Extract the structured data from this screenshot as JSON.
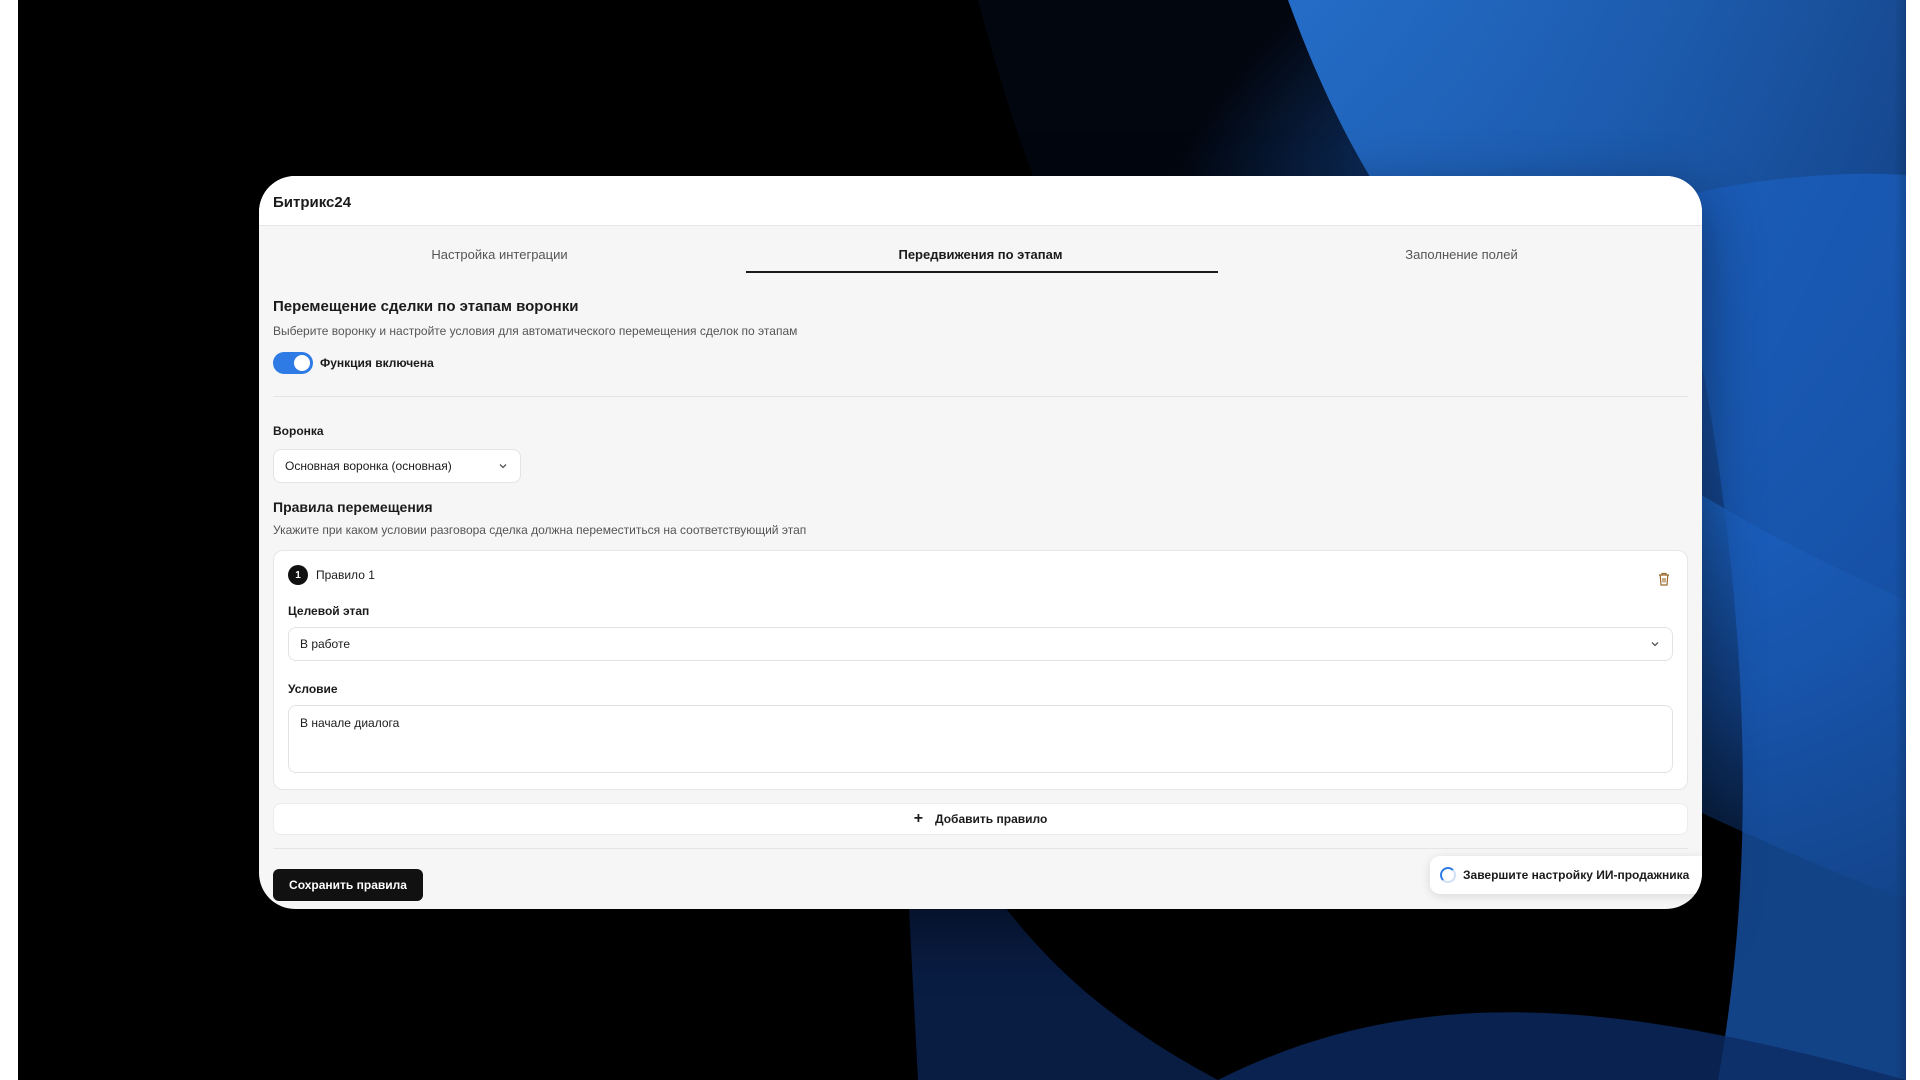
{
  "window": {
    "title": "Битрикс24"
  },
  "tabs": [
    {
      "label": "Настройка интеграции",
      "active": false
    },
    {
      "label": "Передвижения по этапам",
      "active": true
    },
    {
      "label": "Заполнение полей",
      "active": false
    }
  ],
  "section": {
    "title": "Перемещение сделки по этапам воронки",
    "description": "Выберите воронку и настройте условия для автоматического перемещения сделок по этапам",
    "toggle": {
      "label": "Функция включена",
      "on": true
    }
  },
  "funnel": {
    "label": "Воронка",
    "selected": "Основная воронка (основная)"
  },
  "rules": {
    "title": "Правила перемещения",
    "description": "Укажите при каком условии разговора сделка должна переместиться на соответствующий этап",
    "items": [
      {
        "number": "1",
        "name": "Правило 1",
        "target_stage_label": "Целевой этап",
        "target_stage_value": "В работе",
        "condition_label": "Условие",
        "condition_value": "В начале диалога"
      }
    ],
    "add_label": "Добавить правило"
  },
  "save_label": "Сохранить правила",
  "toast": {
    "label": "Завершите настройку ИИ-продажника"
  },
  "colors": {
    "accent": "#2e7be6",
    "primary_button": "#111111",
    "wallpaper": "#1a5fc4"
  },
  "icons": [
    "chevron-down-icon",
    "trash-icon",
    "plus-icon",
    "spinner-icon"
  ]
}
